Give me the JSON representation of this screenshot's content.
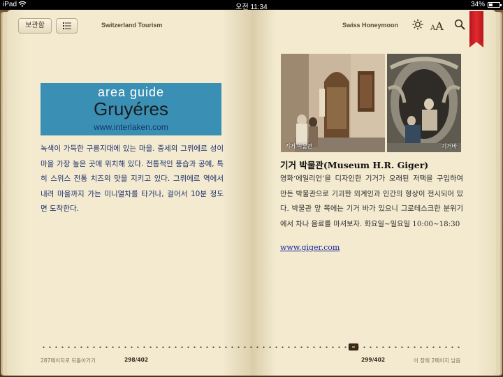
{
  "status_bar": {
    "device": "iPad",
    "time": "오전 11:34",
    "battery": "34%",
    "battery_level": 0.34
  },
  "toolbar": {
    "library_label": "보관함",
    "left_title": "Switzerland Tourism",
    "right_title": "Swiss Honeymoon"
  },
  "left_page": {
    "banner": {
      "line1": "area  guide",
      "line2": "Gruyéres",
      "url": "www.interlaken.com"
    },
    "body": "녹색이 가득한 구릉지대에 있는 마을. 중세의 그뤼에르 성이 마을 가장 높은 곳에 위치해 있다. 전통적인 풍습과 공예, 특히 스위스 전통 치즈의 맛을 지키고 있다. 그뤼에르 역에서 내려 마을까지 가는 미니열차를 타거나, 걸어서 10분 정도면 도착한다."
  },
  "right_page": {
    "photo_captions": [
      "기거 박물관",
      "기거바"
    ],
    "title": "기거 박물관(Museum H.R. Giger)",
    "description": "영화‘에일리언’을 디자인한 기거가 오래된 저택을 구입하여 만든 박물관으로 기괴한 외계인과 인간의 형상이 전시되어 있다. 박물관 앞 쪽에는 기거 바가 있으니 그로테스크한 분위기에서 차나 음료를 마셔보자. 화요일~일요일 10:00~18:30",
    "link": "www.giger.com"
  },
  "footer": {
    "left_back": "287페이지로 되돌아가기",
    "left_page_num": "298/402",
    "right_page_num": "299/402",
    "right_remaining": "이 장에 2페이지 남음"
  }
}
